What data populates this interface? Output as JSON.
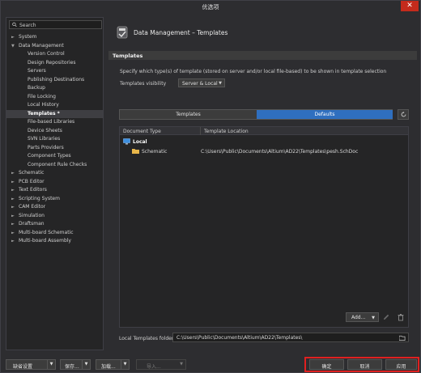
{
  "window": {
    "title": "优选项",
    "close_glyph": "✕"
  },
  "search": {
    "placeholder": "Search"
  },
  "tree": {
    "items": [
      {
        "label": "System",
        "expandable": true,
        "expanded": false,
        "child": false
      },
      {
        "label": "Data Management",
        "expandable": true,
        "expanded": true,
        "child": false
      },
      {
        "label": "Version Control",
        "child": true
      },
      {
        "label": "Design Repositories",
        "child": true
      },
      {
        "label": "Servers",
        "child": true
      },
      {
        "label": "Publishing Destinations",
        "child": true
      },
      {
        "label": "Backup",
        "child": true
      },
      {
        "label": "File Locking",
        "child": true
      },
      {
        "label": "Local History",
        "child": true
      },
      {
        "label": "Templates *",
        "child": true,
        "selected": true
      },
      {
        "label": "File-based Libraries",
        "child": true
      },
      {
        "label": "Device Sheets",
        "child": true
      },
      {
        "label": "SVN Libraries",
        "child": true
      },
      {
        "label": "Parts Providers",
        "child": true
      },
      {
        "label": "Component Types",
        "child": true
      },
      {
        "label": "Component Rule Checks",
        "child": true
      },
      {
        "label": "Schematic",
        "expandable": true,
        "child": false
      },
      {
        "label": "PCB Editor",
        "expandable": true,
        "child": false
      },
      {
        "label": "Text Editors",
        "expandable": true,
        "child": false
      },
      {
        "label": "Scripting System",
        "expandable": true,
        "child": false
      },
      {
        "label": "CAM Editor",
        "expandable": true,
        "child": false
      },
      {
        "label": "Simulation",
        "expandable": true,
        "child": false
      },
      {
        "label": "Draftsman",
        "expandable": true,
        "child": false
      },
      {
        "label": "Multi-board Schematic",
        "expandable": true,
        "child": false
      },
      {
        "label": "Multi-board Assembly",
        "expandable": true,
        "child": false
      }
    ]
  },
  "page": {
    "title": "Data Management – Templates",
    "section": "Templates",
    "description": "Specify which type(s) of template (stored on server and/or local file-based) to be shown in template selection",
    "visibility_label": "Templates visibility",
    "visibility_value": "Server & Local",
    "tabs": [
      {
        "label": "Templates",
        "active": false
      },
      {
        "label": "Defaults",
        "active": true
      }
    ],
    "table": {
      "columns": [
        "Document Type",
        "Template Location"
      ],
      "group": "Local",
      "rows": [
        {
          "type": "Schematic",
          "location": "C:\\Users\\Public\\Documents\\Altium\\AD22\\Templates\\pesh.SchDoc"
        }
      ]
    },
    "add_label": "Add...",
    "folder_label": "Local Templates folder",
    "folder_value": "C:\\Users\\Public\\Documents\\Altium\\AD22\\Templates\\"
  },
  "footer": {
    "default_settings": "缺省设置",
    "save": "保存...",
    "load": "加载...",
    "import": "导入...",
    "ok": "确定",
    "cancel": "取消",
    "apply": "应用"
  },
  "colors": {
    "accent": "#2f6fbf",
    "highlight_border": "#e02020",
    "close_button": "#c42b1c",
    "folder_icon": "#e8b64a"
  }
}
